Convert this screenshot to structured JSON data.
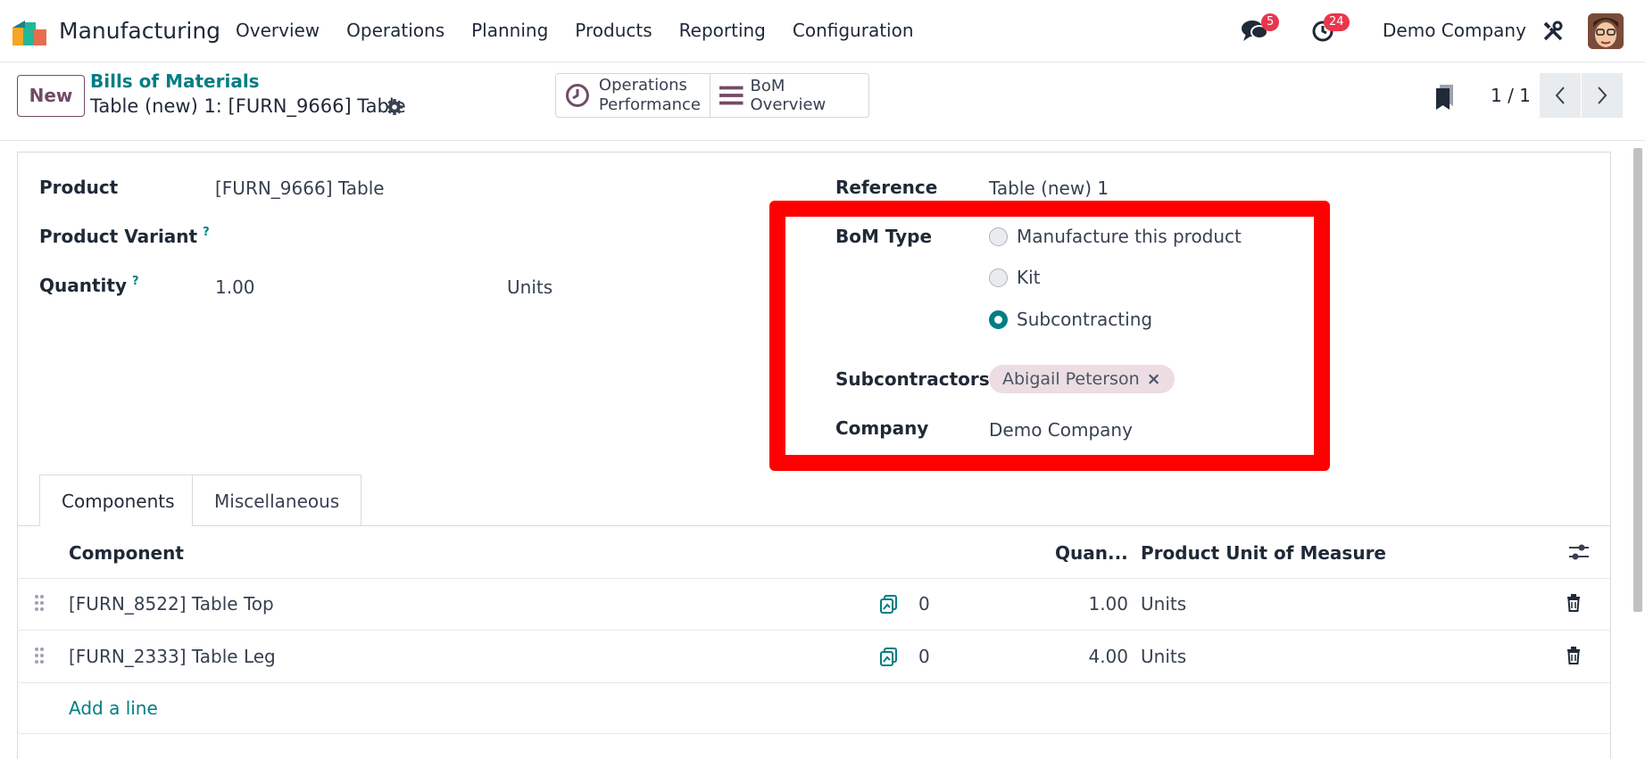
{
  "navbar": {
    "app_name": "Manufacturing",
    "menu": [
      "Overview",
      "Operations",
      "Planning",
      "Products",
      "Reporting",
      "Configuration"
    ],
    "messages_badge": "5",
    "activities_badge": "24",
    "company": "Demo Company"
  },
  "control_panel": {
    "new_label": "New",
    "breadcrumb_parent": "Bills of Materials",
    "breadcrumb_current": "Table (new) 1: [FURN_9666] Table",
    "smart_buttons": {
      "operations_line1": "Operations",
      "operations_line2": "Performance",
      "bom_overview": "BoM Overview"
    },
    "pager": "1 / 1"
  },
  "form": {
    "product_label": "Product",
    "product_value": "[FURN_9666] Table",
    "variant_label": "Product Variant",
    "quantity_label": "Quantity",
    "quantity_value": "1.00",
    "quantity_uom": "Units",
    "reference_label": "Reference",
    "reference_value": "Table (new) 1",
    "bom_type_label": "BoM Type",
    "bom_type_options": [
      "Manufacture this product",
      "Kit",
      "Subcontracting"
    ],
    "bom_type_selected": "Subcontracting",
    "subcontractors_label": "Subcontractors",
    "subcontractor_tag": "Abigail Peterson",
    "company_label": "Company",
    "company_value": "Demo Company",
    "help_mark": "?"
  },
  "tabs": [
    "Components",
    "Miscellaneous"
  ],
  "components_table": {
    "headers": {
      "component": "Component",
      "quantity": "Quan...",
      "uom": "Product Unit of Measure"
    },
    "rows": [
      {
        "component": "[FURN_8522] Table Top",
        "forecast": "0",
        "quantity": "1.00",
        "uom": "Units"
      },
      {
        "component": "[FURN_2333] Table Leg",
        "forecast": "0",
        "quantity": "4.00",
        "uom": "Units"
      }
    ],
    "add_line": "Add a line"
  },
  "colors": {
    "brand": "#714b67",
    "accent": "#017e84",
    "highlight": "#ff0000"
  }
}
